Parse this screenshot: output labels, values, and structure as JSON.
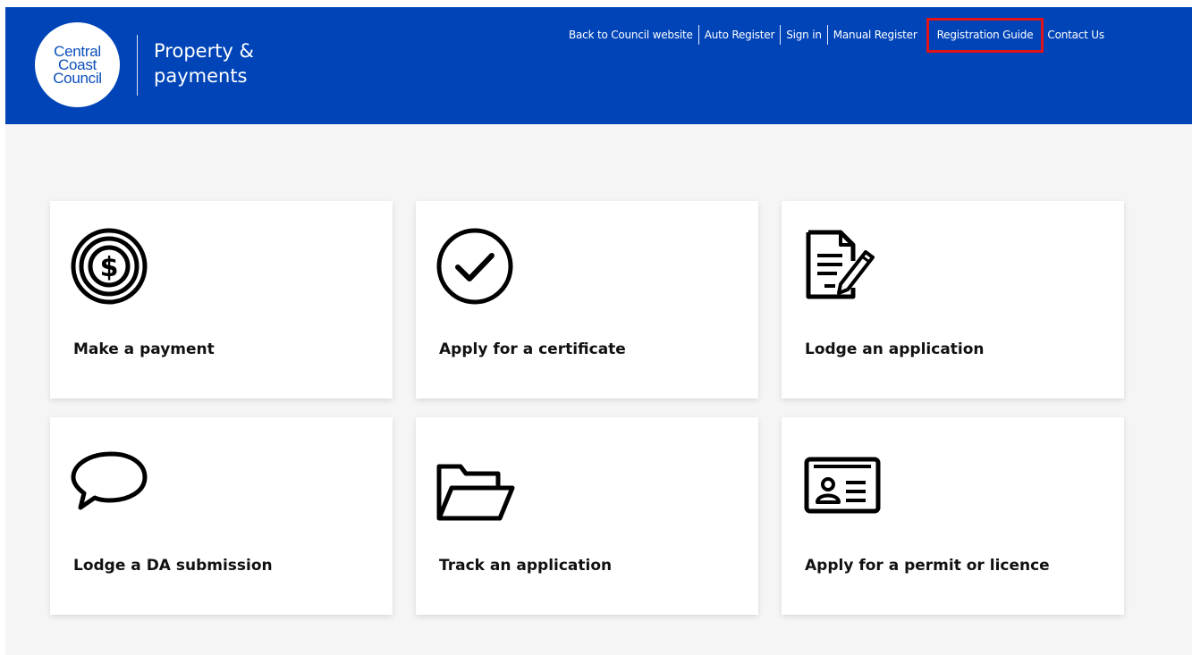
{
  "header": {
    "logo_lines": [
      "Central",
      "Coast",
      "Council"
    ],
    "title_lines": [
      "Property &",
      "payments"
    ],
    "bg_color": "#0044b8"
  },
  "nav": {
    "items": [
      {
        "label": "Back to Council website"
      },
      {
        "label": "Auto Register"
      },
      {
        "label": "Sign in"
      },
      {
        "label": "Manual Register"
      },
      {
        "label": "Registration Guide",
        "highlighted": true
      },
      {
        "label": "Contact Us"
      }
    ],
    "highlight_color": "#e01418"
  },
  "cards": [
    {
      "label": "Make a payment",
      "icon": "dollar-coin-icon"
    },
    {
      "label": "Apply for a certificate",
      "icon": "check-circle-icon"
    },
    {
      "label": "Lodge an application",
      "icon": "document-pen-icon"
    },
    {
      "label": "Lodge a DA submission",
      "icon": "speech-bubble-icon"
    },
    {
      "label": "Track an application",
      "icon": "folder-open-icon"
    },
    {
      "label": "Apply for a permit or licence",
      "icon": "id-card-icon"
    }
  ]
}
